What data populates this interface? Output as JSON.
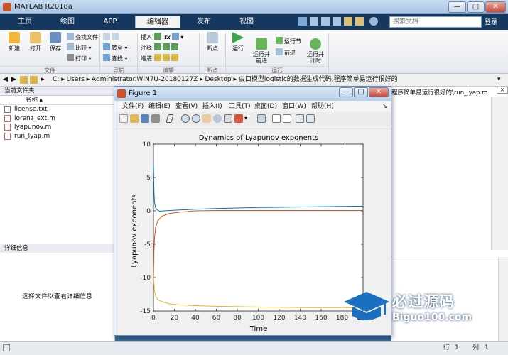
{
  "app": {
    "title": "MATLAB R2018a"
  },
  "window_buttons": [
    "—",
    "□",
    "✕"
  ],
  "ribbon_tabs": [
    "主页",
    "绘图",
    "APP",
    "编辑器",
    "发布",
    "视图"
  ],
  "search": {
    "placeholder": "搜索文档",
    "signin": "登录"
  },
  "ribbon": {
    "file": {
      "new": "新建",
      "open": "打开",
      "save": "保存",
      "find_files": "查找文件",
      "compare": "比较",
      "print": "打印",
      "group": "文件"
    },
    "nav": {
      "goto": "转至",
      "find": "查找",
      "group": "导航"
    },
    "edit": {
      "insert": "插入",
      "comment": "注释",
      "indent": "缩进",
      "group": "编辑"
    },
    "breakpoints": {
      "label": "断点",
      "group": "断点"
    },
    "run": {
      "run": "运行",
      "run_advance": "运行并\n前进",
      "run_section": "运行节",
      "advance": "前进",
      "run_time": "运行并\n计时",
      "group": "运行"
    }
  },
  "address": {
    "path": [
      "C:",
      "Users",
      "Administrator.WIN7U-20180127Z",
      "Desktop",
      "虫口模型logistic的数据生成代码,程序简单易运行很好的"
    ]
  },
  "current_folder": {
    "header": "当前文件夹",
    "col_name": "名称",
    "files": [
      "license.txt",
      "lorenz_ext.m",
      "lyapunov.m",
      "run_lyap.m"
    ]
  },
  "details": {
    "header": "详细信息",
    "empty_text": "选择文件以查看详细信息"
  },
  "editor_path": "程序简单易运行很好的\\run_lyap.m",
  "figure": {
    "title": "Figure 1",
    "menus": [
      "文件(F)",
      "编辑(E)",
      "查看(V)",
      "插入(I)",
      "工具(T)",
      "桌面(D)",
      "窗口(W)",
      "帮助(H)"
    ]
  },
  "status": {
    "row_label": "行",
    "row_value": "1",
    "col_label": "列",
    "col_value": "1"
  },
  "watermark": {
    "line1": "必过源码",
    "line2": "Biguo100.com"
  },
  "colors": {
    "blue_series": "#0072bd",
    "orange_series": "#d95319",
    "yellow_series": "#edb120"
  },
  "chart_data": {
    "type": "line",
    "title": "Dynamics of Lyapunov exponents",
    "xlabel": "Time",
    "ylabel": "Lyapunov exponents",
    "xlim": [
      0,
      200
    ],
    "ylim": [
      -15,
      10
    ],
    "xticks": [
      0,
      20,
      40,
      60,
      80,
      100,
      120,
      140,
      160,
      180,
      200
    ],
    "yticks": [
      -15,
      -10,
      -5,
      0,
      5,
      10
    ],
    "grid": false,
    "series": [
      {
        "color": "#0072bd",
        "x": [
          0,
          0.5,
          1,
          2,
          4,
          6,
          10,
          20,
          40,
          60,
          100,
          150,
          200
        ],
        "values": [
          7,
          3,
          1.2,
          0.4,
          0.1,
          -0.05,
          0,
          0.1,
          0.25,
          0.35,
          0.5,
          0.6,
          0.7
        ]
      },
      {
        "color": "#d95319",
        "x": [
          0,
          0.5,
          1,
          2,
          4,
          8,
          15,
          25,
          40,
          60,
          100,
          150,
          200
        ],
        "values": [
          -10,
          -6,
          -4,
          -2.5,
          -1.5,
          -0.8,
          -0.4,
          -0.2,
          0,
          0.05,
          0.05,
          0.05,
          0.05
        ]
      },
      {
        "color": "#edb120",
        "x": [
          0,
          0.5,
          1,
          2,
          4,
          8,
          15,
          25,
          40,
          60,
          100,
          150,
          200
        ],
        "values": [
          -10,
          -11,
          -12,
          -12.8,
          -13.3,
          -13.6,
          -13.9,
          -14.1,
          -14.2,
          -14.3,
          -14.4,
          -14.5,
          -14.5
        ]
      }
    ]
  }
}
